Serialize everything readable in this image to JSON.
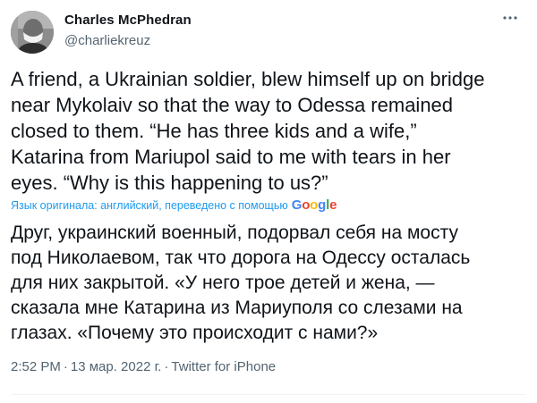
{
  "author": {
    "name": "Charles McPhedran",
    "handle": "@charliekreuz"
  },
  "tweet": {
    "text_original": "A friend, a Ukrainian soldier, blew himself up on bridge\nnear Mykolaiv  so that the way to Odessa remained\nclosed to them. “He has three kids and a wife,”\nKatarina from Mariupol said to me with tears in her\neyes. “Why is this happening to us?”",
    "translation_note": "Язык оригинала: английский, переведено с помощью",
    "translation_provider": "Google",
    "text_translated": "Друг, украинский военный, подорвал себя на мосту\nпод Николаевом, так что дорога на Одессу осталась\nдля них закрытой. «У него трое детей и жена, —\nсказала мне Катарина из Мариуполя со слезами на\nглазах. «Почему это происходит с нами?»",
    "time": "2:52 PM",
    "date": "13 мар. 2022 г.",
    "source": "Twitter for iPhone",
    "separator": "·"
  },
  "icons": {
    "more": "more-horizontal-icon",
    "avatar": "avatar-image"
  },
  "colors": {
    "text_primary": "#0f1419",
    "text_secondary": "#536471",
    "link": "#1d9bf0"
  }
}
